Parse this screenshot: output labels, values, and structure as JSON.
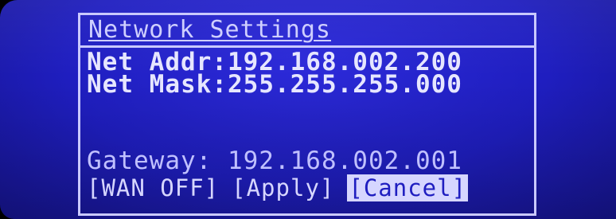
{
  "screen": {
    "title": "Network Settings",
    "net_addr": {
      "label": "Net Addr:",
      "value": "192.168.002.200"
    },
    "net_mask": {
      "label": "Net Mask:",
      "value": "255.255.255.000"
    },
    "gateway": {
      "label": "Gateway: ",
      "value": "192.168.002.001"
    },
    "buttons": {
      "wan": "[WAN OFF]",
      "apply": "[Apply]",
      "cancel": "[Cancel]"
    },
    "selected_button": "cancel"
  }
}
